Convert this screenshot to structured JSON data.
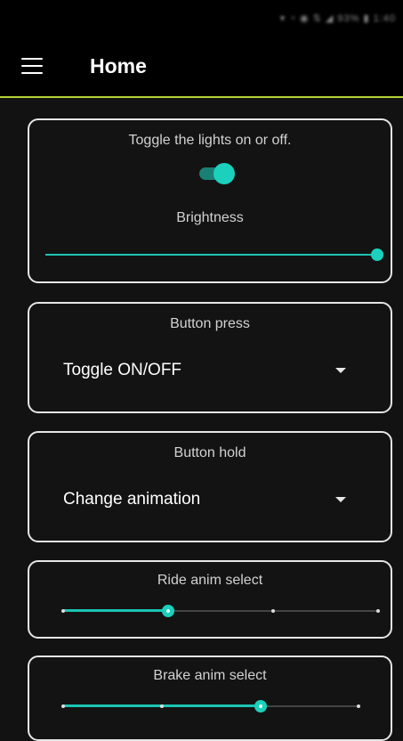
{
  "status_bar": {
    "icons": "▾ ◔ ◉ ⇅ ◢ 93% ▮ 1:40"
  },
  "app_bar": {
    "title": "Home"
  },
  "lights_card": {
    "toggle_label": "Toggle the lights on or off.",
    "toggle_on": true,
    "brightness_label": "Brightness",
    "brightness_value": 1.0
  },
  "button_press_card": {
    "label": "Button press",
    "selected": "Toggle ON/OFF"
  },
  "button_hold_card": {
    "label": "Button hold",
    "selected": "Change animation"
  },
  "ride_anim_card": {
    "label": "Ride anim select",
    "steps": 4,
    "selected_index": 1
  },
  "brake_anim_card": {
    "label": "Brake anim select",
    "steps": 4,
    "selected_index": 2
  },
  "colors": {
    "accent": "#1bd0bd",
    "divider": "#b5d334",
    "card_border": "#e6e6e6"
  }
}
